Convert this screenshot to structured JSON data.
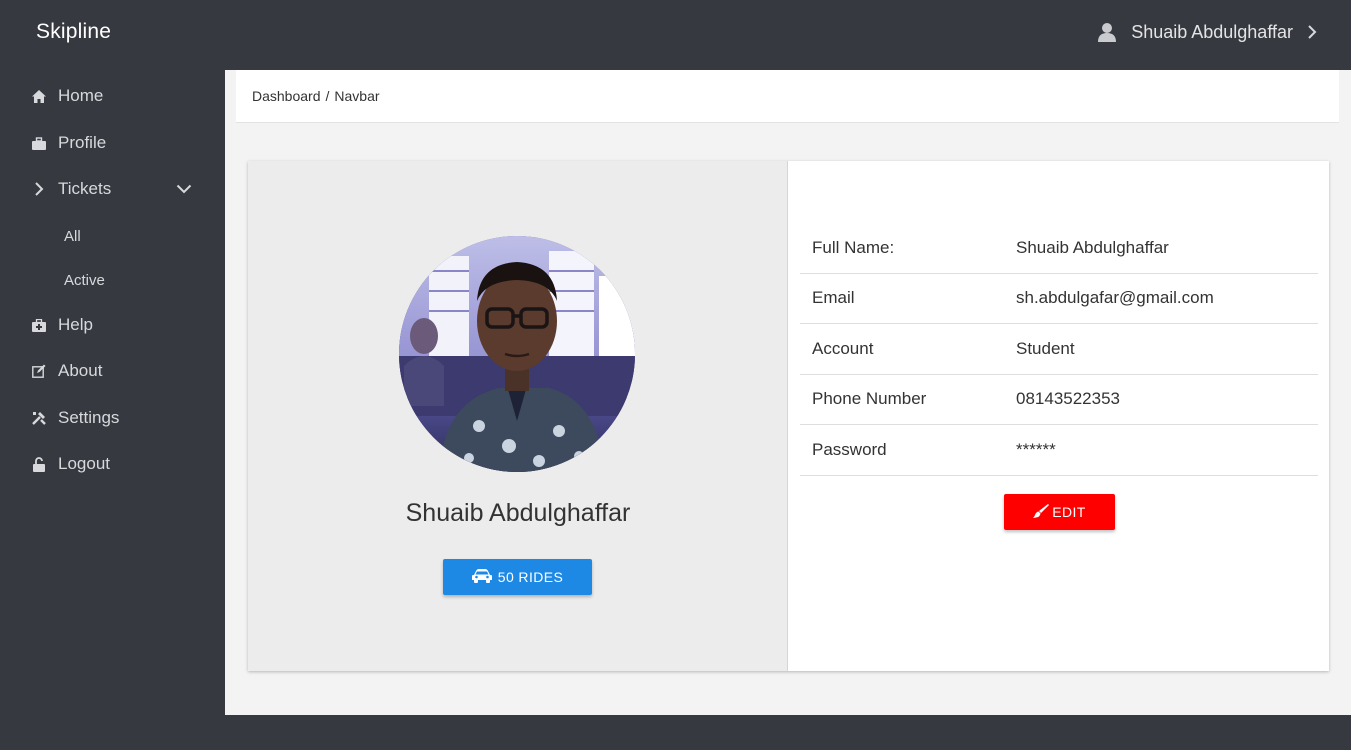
{
  "app": {
    "brand": "Skipline"
  },
  "user_menu": {
    "name": "Shuaib Abdulghaffar",
    "icon": "user-icon",
    "chevron": "chevron-right-icon"
  },
  "sidebar": {
    "items": [
      {
        "label": "Home",
        "icon": "home-icon"
      },
      {
        "label": "Profile",
        "icon": "briefcase-icon"
      },
      {
        "label": "Tickets",
        "icon": "chevron-right-icon",
        "expanded": true,
        "children": [
          {
            "label": "All"
          },
          {
            "label": "Active"
          }
        ]
      },
      {
        "label": "Help",
        "icon": "medkit-icon"
      },
      {
        "label": "About",
        "icon": "edit-icon"
      },
      {
        "label": "Settings",
        "icon": "tools-icon"
      },
      {
        "label": "Logout",
        "icon": "unlock-icon"
      }
    ]
  },
  "breadcrumb": {
    "items": [
      "Dashboard",
      "Navbar"
    ],
    "separator": "/"
  },
  "profile": {
    "name": "Shuaib Abdulghaffar",
    "rides_button": "50 RIDES",
    "rides_icon": "car-icon",
    "fields": [
      {
        "label": "Full Name:",
        "value": "Shuaib Abdulghaffar"
      },
      {
        "label": "Email",
        "value": "sh.abdulgafar@gmail.com"
      },
      {
        "label": "Account",
        "value": "Student"
      },
      {
        "label": "Phone Number",
        "value": "08143522353"
      },
      {
        "label": "Password",
        "value": "******"
      }
    ],
    "edit_button": "EDIT",
    "edit_icon": "paintbrush-icon"
  },
  "colors": {
    "sidebar_bg": "#363940",
    "primary": "#1e88e5",
    "danger": "#ff0000",
    "panel_bg": "#ececec"
  }
}
